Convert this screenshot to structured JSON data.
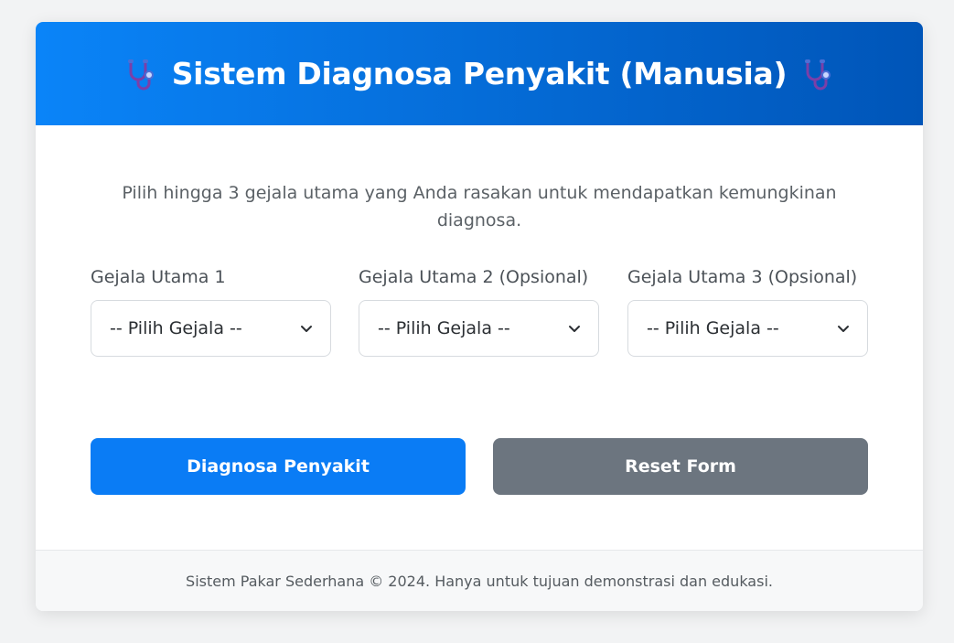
{
  "header": {
    "title": "Sistem Diagnosa Penyakit (Manusia)",
    "left_icon": "stethoscope-icon",
    "right_icon": "stethoscope-icon"
  },
  "intro": "Pilih hingga 3 gejala utama yang Anda rasakan untuk mendapatkan kemungkinan diagnosa.",
  "fields": [
    {
      "label": "Gejala Utama 1",
      "selected": "-- Pilih Gejala --"
    },
    {
      "label": "Gejala Utama 2 (Opsional)",
      "selected": "-- Pilih Gejala --"
    },
    {
      "label": "Gejala Utama 3 (Opsional)",
      "selected": "-- Pilih Gejala --"
    }
  ],
  "buttons": {
    "diagnose": "Diagnosa Penyakit",
    "reset": "Reset Form"
  },
  "footer": "Sistem Pakar Sederhana © 2024. Hanya untuk tujuan demonstrasi dan edukasi.",
  "colors": {
    "header_start": "#0a84f8",
    "header_end": "#0055b8",
    "primary": "#0a7cf5",
    "secondary": "#6c757f"
  }
}
